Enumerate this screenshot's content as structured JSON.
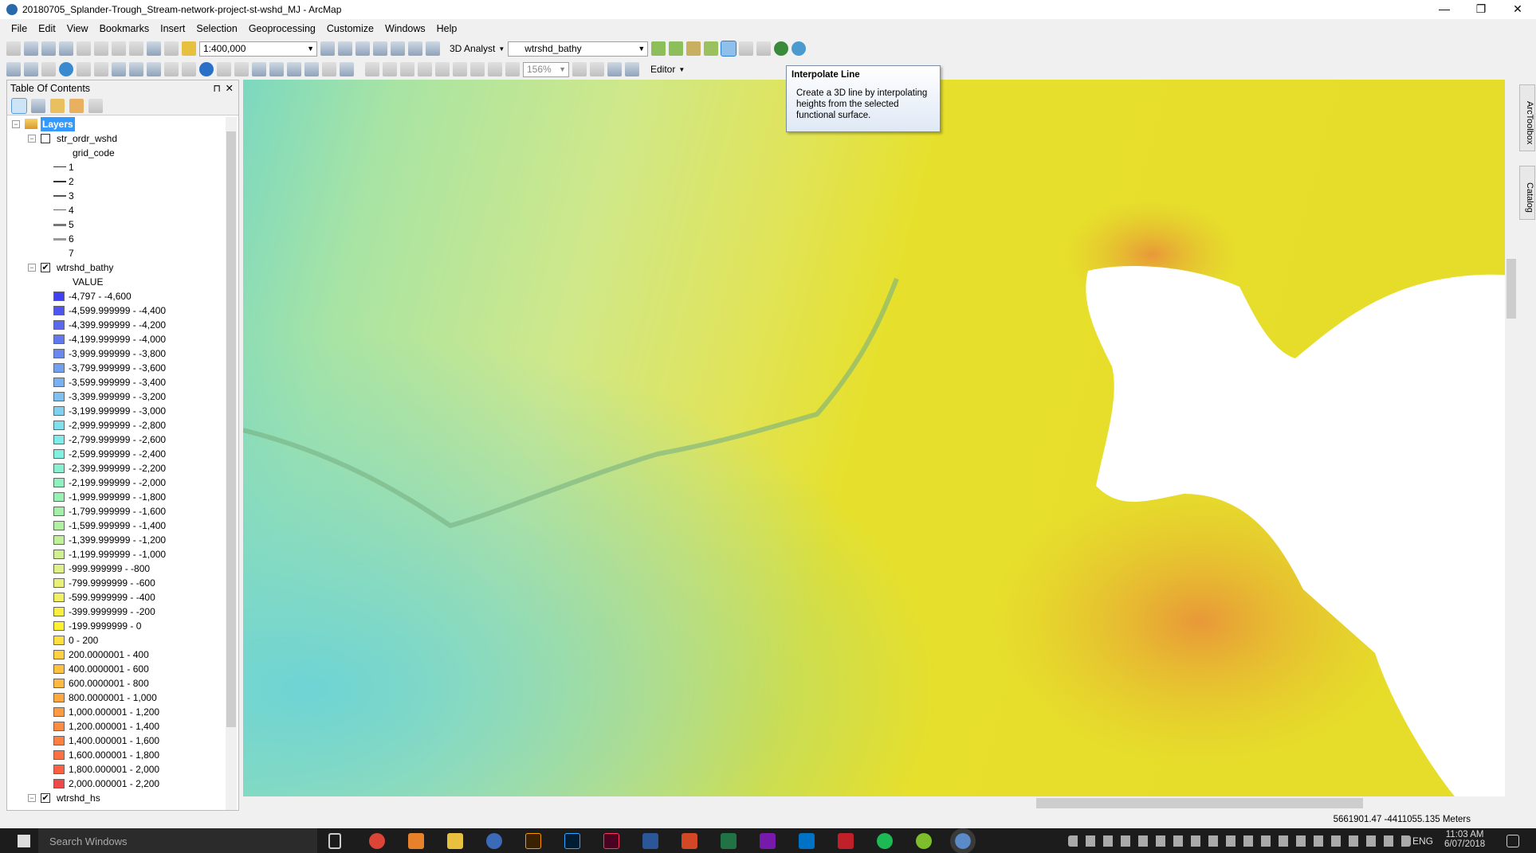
{
  "window": {
    "title": "20180705_Splander-Trough_Stream-network-project-st-wshd_MJ - ArcMap",
    "min": "—",
    "max": "❐",
    "close": "✕"
  },
  "menu": [
    "File",
    "Edit",
    "View",
    "Bookmarks",
    "Insert",
    "Selection",
    "Geoprocessing",
    "Customize",
    "Windows",
    "Help"
  ],
  "toolbar": {
    "scale": "1:400,000",
    "analyst_label": "3D Analyst",
    "layer_select": "wtrshd_bathy",
    "zoom_percent": "156%",
    "editor_label": "Editor"
  },
  "tooltip": {
    "title": "Interpolate Line",
    "body": "Create a 3D line by interpolating heights from the selected functional surface."
  },
  "toc": {
    "title": "Table Of Contents",
    "pin": "⊓",
    "close": "✕",
    "root": "Layers",
    "layer1": {
      "name": "str_ordr_wshd",
      "checked": false,
      "field": "grid_code",
      "classes": [
        "1",
        "2",
        "3",
        "4",
        "5",
        "6",
        "7"
      ]
    },
    "layer2": {
      "name": "wtrshd_bathy",
      "checked": true,
      "field": "VALUE",
      "classes": [
        {
          "label": "-4,797 - -4,600",
          "color": "#4040f0"
        },
        {
          "label": "-4,599.999999 - -4,400",
          "color": "#4f55f0"
        },
        {
          "label": "-4,399.999999 - -4,200",
          "color": "#5a68f0"
        },
        {
          "label": "-4,199.999999 - -4,000",
          "color": "#6278f0"
        },
        {
          "label": "-3,999.999999 - -3,800",
          "color": "#6a88f0"
        },
        {
          "label": "-3,799.999999 - -3,600",
          "color": "#72a0f0"
        },
        {
          "label": "-3,599.999999 - -3,400",
          "color": "#78b0f0"
        },
        {
          "label": "-3,399.999999 - -3,200",
          "color": "#7ec0f0"
        },
        {
          "label": "-3,199.999999 - -3,000",
          "color": "#80d0f0"
        },
        {
          "label": "-2,999.999999 - -2,800",
          "color": "#80e0ee"
        },
        {
          "label": "-2,799.999999 - -2,600",
          "color": "#80ecea"
        },
        {
          "label": "-2,599.999999 - -2,400",
          "color": "#80f0e0"
        },
        {
          "label": "-2,399.999999 - -2,200",
          "color": "#88f0d0"
        },
        {
          "label": "-2,199.999999 - -2,000",
          "color": "#90f0c0"
        },
        {
          "label": "-1,999.999999 - -1,800",
          "color": "#98f0b4"
        },
        {
          "label": "-1,799.999999 - -1,600",
          "color": "#a4f0a8"
        },
        {
          "label": "-1,599.999999 - -1,400",
          "color": "#b0f0a0"
        },
        {
          "label": "-1,399.999999 - -1,200",
          "color": "#c0f098"
        },
        {
          "label": "-1,199.999999 - -1,000",
          "color": "#d0f090"
        },
        {
          "label": "-999.999999 - -800",
          "color": "#e0f088"
        },
        {
          "label": "-799.9999999 - -600",
          "color": "#e8f078"
        },
        {
          "label": "-599.9999999 - -400",
          "color": "#f0f060"
        },
        {
          "label": "-399.9999999 - -200",
          "color": "#f8f040"
        },
        {
          "label": "-199.9999999 - 0",
          "color": "#fff030"
        },
        {
          "label": "0 - 200",
          "color": "#ffe040"
        },
        {
          "label": "200.0000001 - 400",
          "color": "#ffd040"
        },
        {
          "label": "400.0000001 - 600",
          "color": "#ffc040"
        },
        {
          "label": "600.0000001 - 800",
          "color": "#ffb840"
        },
        {
          "label": "800.0000001 - 1,000",
          "color": "#ffa840"
        },
        {
          "label": "1,000.000001 - 1,200",
          "color": "#ff9a40"
        },
        {
          "label": "1,200.000001 - 1,400",
          "color": "#ff8c40"
        },
        {
          "label": "1,400.000001 - 1,600",
          "color": "#ff8040"
        },
        {
          "label": "1,600.000001 - 1,800",
          "color": "#ff7040"
        },
        {
          "label": "1,800.000001 - 2,000",
          "color": "#ff6040"
        },
        {
          "label": "2,000.000001 - 2,200",
          "color": "#f04848"
        }
      ]
    },
    "layer3": {
      "name": "wtrshd_hs",
      "checked": true
    }
  },
  "dock": {
    "arctoolbox": "ArcToolbox",
    "catalog": "Catalog"
  },
  "status": {
    "coords": "5661901.47  -4411055.135 Meters"
  },
  "taskbar": {
    "search": "Search Windows",
    "lang": "ENG",
    "time": "11:03 AM",
    "date": "6/07/2018"
  }
}
